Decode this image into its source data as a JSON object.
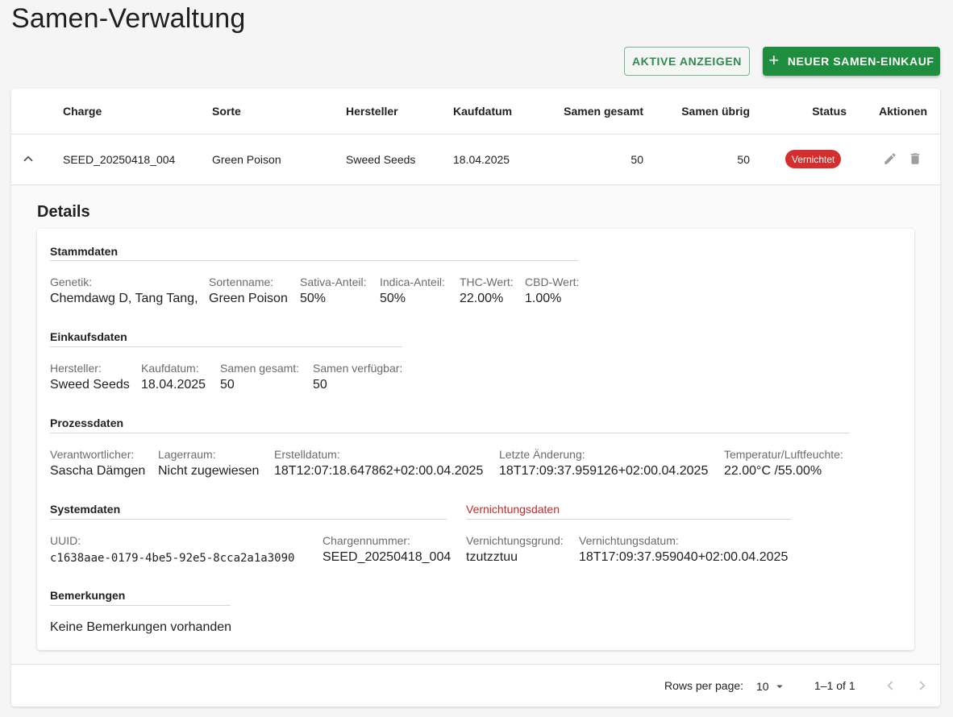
{
  "page": {
    "title": "Samen-Verwaltung"
  },
  "toolbar": {
    "active_label": "Aktive anzeigen",
    "new_label": "Neuer Samen-Einkauf"
  },
  "table": {
    "headers": [
      "Charge",
      "Sorte",
      "Hersteller",
      "Kaufdatum",
      "Samen gesamt",
      "Samen übrig",
      "Status",
      "Aktionen"
    ],
    "row": {
      "charge": "SEED_20250418_004",
      "sorte": "Green Poison",
      "hersteller": "Sweed Seeds",
      "kaufdatum": "18.04.2025",
      "gesamt": "50",
      "uebrig": "50",
      "status": "Vernichtet",
      "status_color": "#d32f2f"
    }
  },
  "details": {
    "title": "Details",
    "stammdaten": {
      "title": "Stammdaten",
      "fields": [
        {
          "label": "Genetik:",
          "value": "Chemdawg D, Tang Tang,"
        },
        {
          "label": "Sortenname:",
          "value": "Green Poison"
        },
        {
          "label": "Sativa-Anteil:",
          "value": "50%"
        },
        {
          "label": "Indica-Anteil:",
          "value": "50%"
        },
        {
          "label": "THC-Wert:",
          "value": "22.00%"
        },
        {
          "label": "CBD-Wert:",
          "value": "1.00%"
        }
      ]
    },
    "einkaufsdaten": {
      "title": "Einkaufsdaten",
      "fields": [
        {
          "label": "Hersteller:",
          "value": "Sweed Seeds"
        },
        {
          "label": "Kaufdatum:",
          "value": "18.04.2025"
        },
        {
          "label": "Samen gesamt:",
          "value": "50"
        },
        {
          "label": "Samen verfügbar:",
          "value": "50"
        }
      ]
    },
    "prozessdaten": {
      "title": "Prozessdaten",
      "fields": [
        {
          "label": "Verantwortlicher:",
          "value": "Sascha Dämgen"
        },
        {
          "label": "Lagerraum:",
          "value": "Nicht zugewiesen"
        },
        {
          "label": "Erstelldatum:",
          "value": "18T12:07:18.647862+02:00.04.2025"
        },
        {
          "label": "Letzte Änderung:",
          "value": "18T17:09:37.959126+02:00.04.2025"
        },
        {
          "label": "Temperatur/Luftfeuchte:",
          "value": "22.00°C /55.00%"
        }
      ]
    },
    "systemdaten": {
      "title": "Systemdaten",
      "fields": [
        {
          "label": "UUID:",
          "value": "c1638aae-0179-4be5-92e5-8cca2a1a3090"
        },
        {
          "label": "Chargennummer:",
          "value": "SEED_20250418_004"
        }
      ]
    },
    "vernichtungsdaten": {
      "title": "Vernichtungsdaten",
      "title_color": "#c62828",
      "fields": [
        {
          "label": "Vernichtungsgrund:",
          "value": "tzutzztuu"
        },
        {
          "label": "Vernichtungsdatum:",
          "value": "18T17:09:37.959040+02:00.04.2025"
        }
      ]
    },
    "bemerkungen": {
      "title": "Bemerkungen",
      "text": "Keine Bemerkungen vorhanden"
    }
  },
  "pagination": {
    "rows_label": "Rows per page:",
    "rows_value": "10",
    "range": "1–1 of 1"
  },
  "icons": [
    "chevron-up-icon",
    "edit-icon",
    "delete-icon",
    "plus-icon",
    "dropdown-arrow-icon",
    "chevron-left-icon",
    "chevron-right-icon"
  ]
}
